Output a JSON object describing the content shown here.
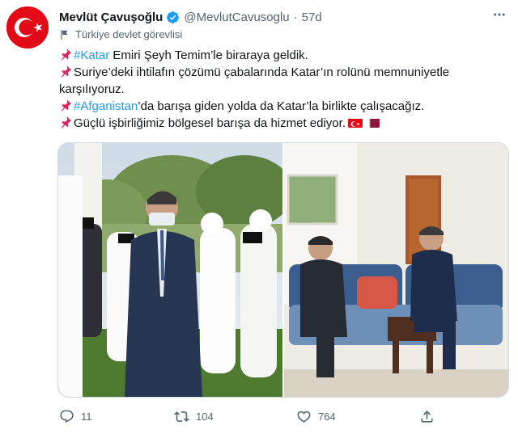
{
  "tweet": {
    "author_name": "Mevlüt Çavuşoğlu",
    "handle": "@MevlutCavusoglu",
    "separator": "·",
    "time": "57d",
    "government_label": "Türkiye devlet görevlisi",
    "line1_tag": "#Katar",
    "line1_text": " Emiri Şeyh Temim’le biraraya geldik.",
    "line2_text": "Suriye’deki ihtilafın çözümü çabalarında Katar’ın rolünü memnuniyetle karşılıyoruz.",
    "line3_tag": "#Afganistan",
    "line3_text": "’da barışa giden yolda da Katar’la birlikte çalışacağız.",
    "line4_text": "Güçlü işbirliğimiz bölgesel barışa da hizmet ediyor."
  },
  "actions": {
    "reply_count": "11",
    "retweet_count": "104",
    "like_count": "764"
  },
  "icons": [
    "turkish-flag-avatar",
    "verified-badge-icon",
    "more-icon",
    "flag-label-icon",
    "pushpin-icon",
    "turkey-flag-emoji",
    "qatar-flag-emoji",
    "reply-icon",
    "retweet-icon",
    "like-icon",
    "share-icon"
  ],
  "colors": {
    "accent": "#1d9bf0",
    "verified": "#1d9bf0",
    "secondary_text": "#536471",
    "turkey_red": "#e30a17",
    "qatar_maroon": "#8a1538"
  }
}
